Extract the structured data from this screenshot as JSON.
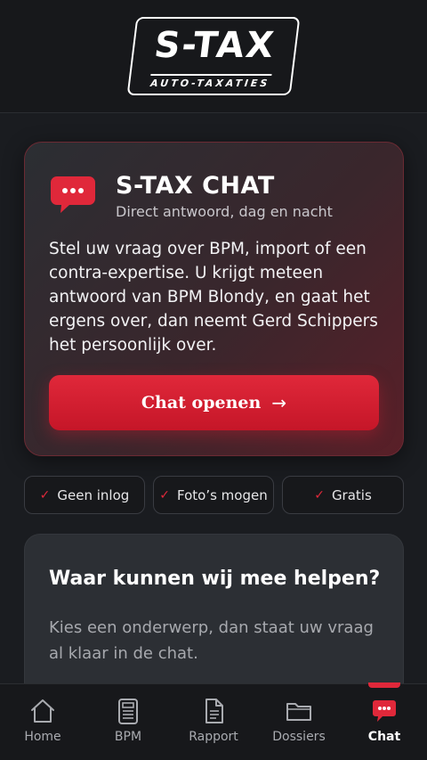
{
  "brand": {
    "logo_main": "S-TAX",
    "logo_sub": "AUTO-TAXATIES"
  },
  "chat_card": {
    "icon": "chat-bubble-icon",
    "title": "S-TAX CHAT",
    "subtitle": "Direct antwoord, dag en nacht",
    "body": "Stel uw vraag over BPM, import of een contra-expertise. U krijgt meteen antwoord van BPM Blondy, en gaat het ergens over, dan neemt Gerd Schippers het persoonlijk over.",
    "cta_label": "Chat openen",
    "cta_arrow": "→"
  },
  "features": [
    {
      "label": "Geen inlog",
      "icon": "check-icon"
    },
    {
      "label": "Foto’s mogen",
      "icon": "check-icon"
    },
    {
      "label": "Gratis",
      "icon": "check-icon"
    }
  ],
  "help_card": {
    "title": "Waar kunnen wij mee helpen?",
    "text": "Kies een onderwerp, dan staat uw vraag al klaar in de chat."
  },
  "bottom_nav": {
    "items": [
      {
        "label": "Home",
        "icon": "home-icon"
      },
      {
        "label": "BPM",
        "icon": "calculator-icon"
      },
      {
        "label": "Rapport",
        "icon": "document-icon"
      },
      {
        "label": "Dossiers",
        "icon": "folder-icon"
      },
      {
        "label": "Chat",
        "icon": "chat-bubble-icon"
      }
    ],
    "active": "Chat"
  },
  "colors": {
    "accent": "#e0283a",
    "background": "#1a1c20",
    "card": "#2c2f34"
  }
}
